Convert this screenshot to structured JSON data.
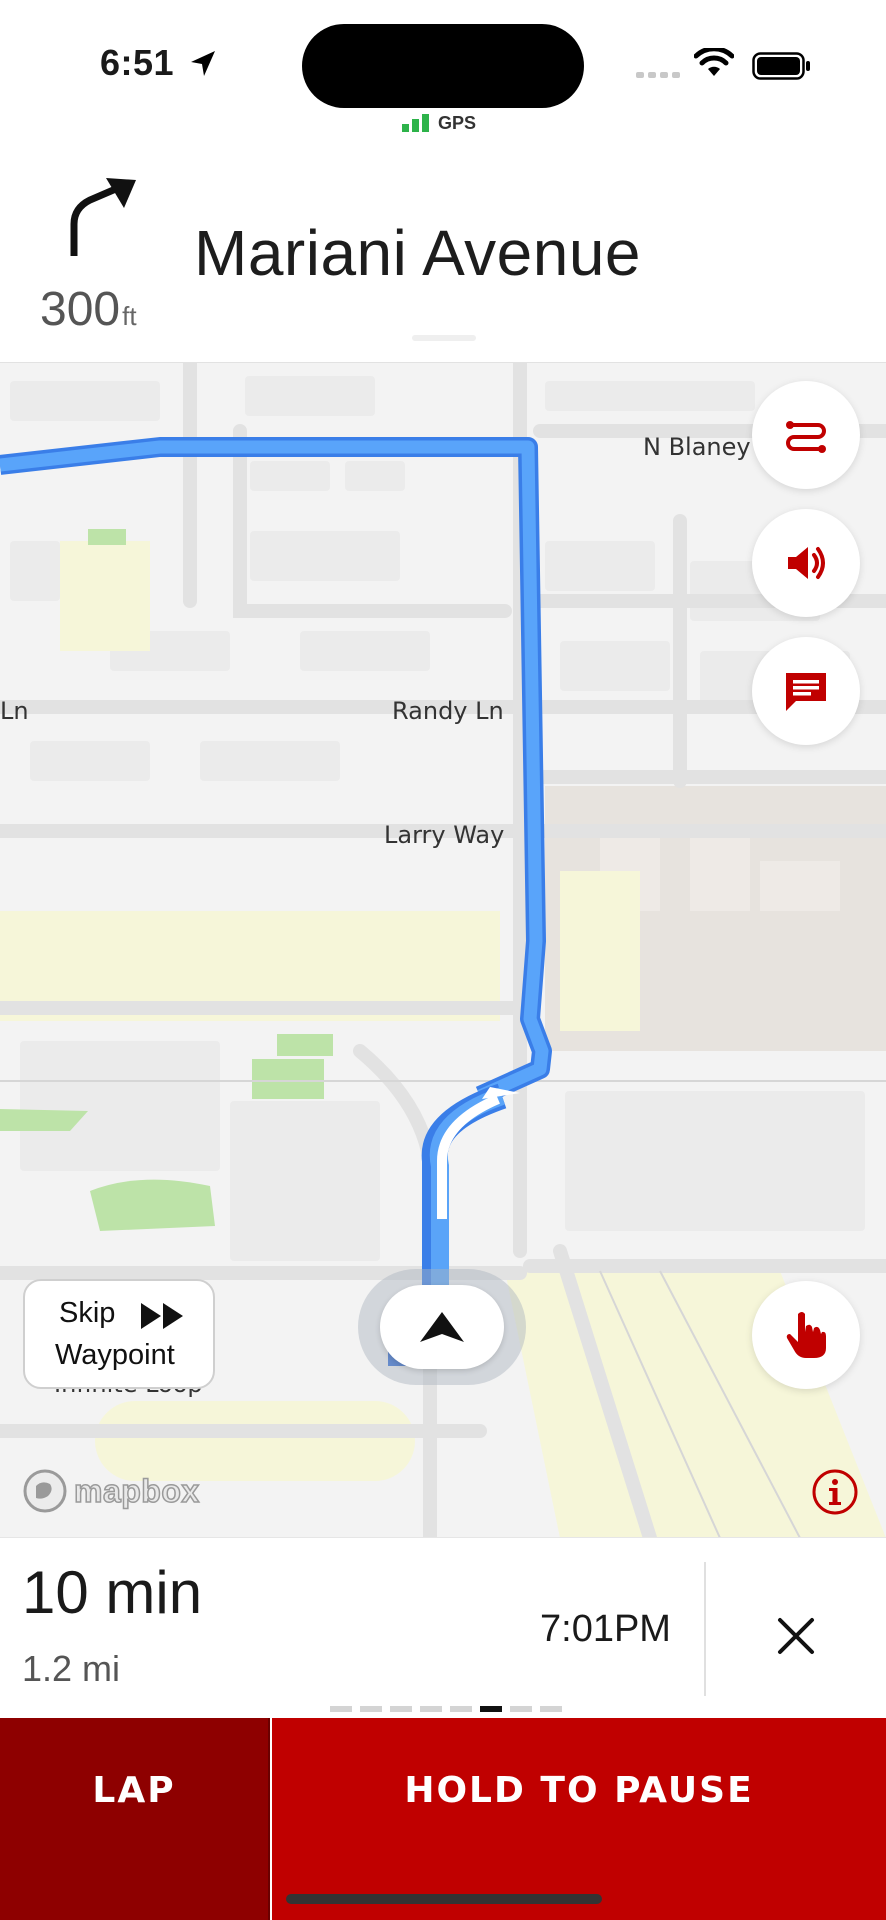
{
  "status_bar": {
    "time": "6:51",
    "gps_label": "GPS",
    "icons": [
      "location-arrow-icon",
      "cellular-icon",
      "wifi-icon",
      "battery-icon"
    ]
  },
  "banner": {
    "maneuver_icon": "turn-right-icon",
    "distance_value": "300",
    "distance_unit": "ft",
    "street": "Mariani Avenue"
  },
  "map": {
    "labels": {
      "n_blaney": "N Blaney",
      "ln_fragment": "Ln",
      "randy_ln": "Randy Ln",
      "larry_way": "Larry Way",
      "infinite_loop": "Infinite Loop"
    },
    "route_color": "#4a9bf7",
    "attribution": "mapbox",
    "skip_waypoint": {
      "line1": "Skip",
      "line2": "Waypoint"
    },
    "controls": [
      "route-overview-icon",
      "volume-icon",
      "feedback-icon",
      "hand-pointer-icon",
      "info-icon"
    ]
  },
  "summary": {
    "duration": "10 min",
    "distance": "1.2 mi",
    "arrival_time": "7:01PM",
    "close_icon": "close-icon"
  },
  "pager": {
    "count": 8,
    "active_index": 5
  },
  "actions": {
    "lap_label": "LAP",
    "pause_label": "HOLD TO PAUSE"
  },
  "colors": {
    "accent_red": "#c00000",
    "dark_red": "#8e0000",
    "route_blue": "#4a9bf7"
  }
}
